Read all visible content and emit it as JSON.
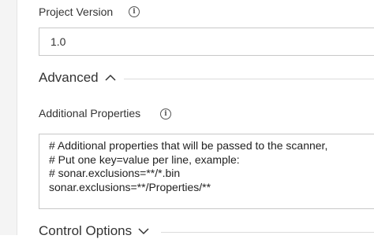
{
  "project_version": {
    "label": "Project Version",
    "info_icon": "info-icon",
    "value": "1.0"
  },
  "advanced": {
    "title": "Advanced",
    "expanded": true,
    "chevron_icon": "chevron-up-icon"
  },
  "additional_properties": {
    "label": "Additional Properties",
    "info_icon": "info-icon",
    "value": "# Additional properties that will be passed to the scanner,\n# Put one key=value per line, example:\n# sonar.exclusions=**/*.bin\nsonar.exclusions=**/Properties/**"
  },
  "control_options": {
    "title": "Control Options",
    "expanded": false,
    "chevron_icon": "chevron-down-icon"
  }
}
